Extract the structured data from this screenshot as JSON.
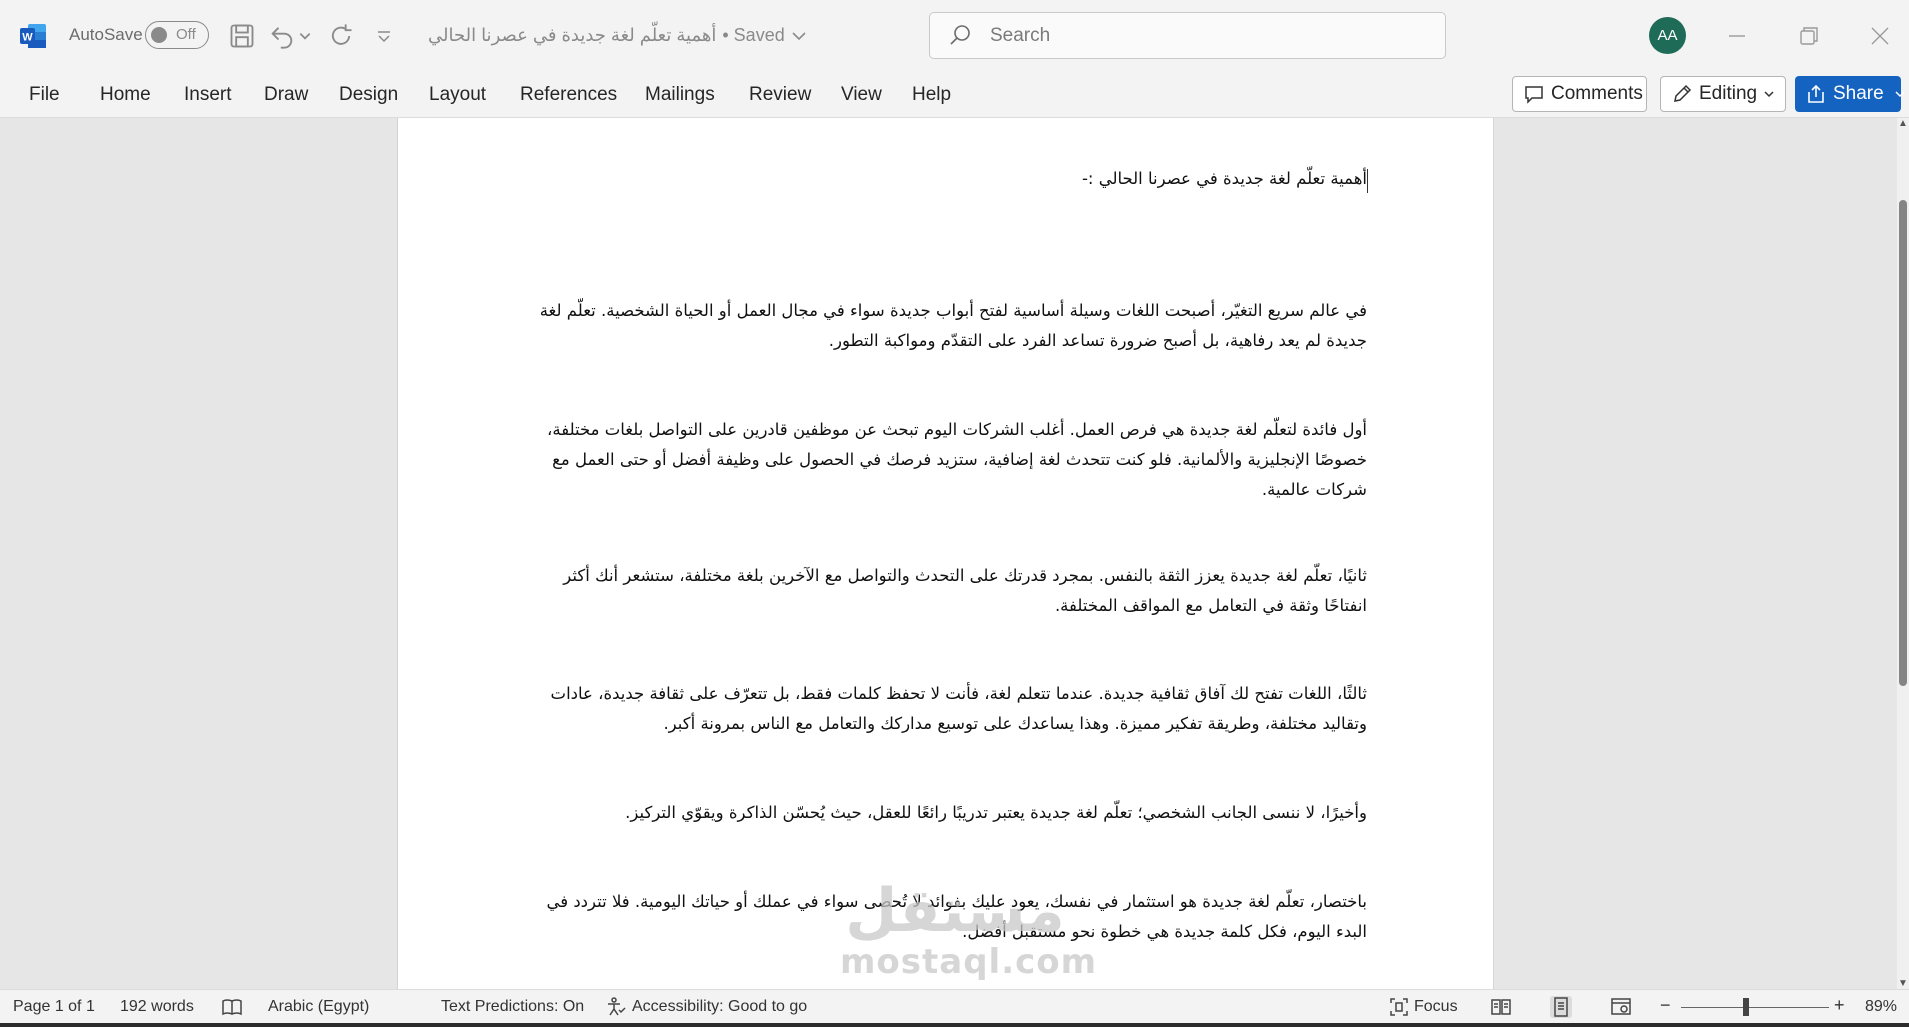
{
  "titlebar": {
    "autosave_label": "AutoSave",
    "autosave_state": "Off",
    "document_title": "أهمية تعلّم لغة جديدة في عصرنا الحالي",
    "save_status": "• Saved",
    "search_placeholder": "Search",
    "user_initials": "AA"
  },
  "ribbon": {
    "tabs": [
      "File",
      "Home",
      "Insert",
      "Draw",
      "Design",
      "Layout",
      "References",
      "Mailings",
      "Review",
      "View",
      "Help"
    ],
    "comments_label": "Comments",
    "editing_label": "Editing",
    "share_label": "Share"
  },
  "document": {
    "heading": "أهمية تعلّم لغة جديدة في عصرنا الحالي :-",
    "paragraphs": [
      "في عالم سريع التغيّر، أصبحت اللغات وسيلة أساسية لفتح أبواب جديدة سواء في مجال العمل أو الحياة الشخصية. تعلّم لغة جديدة لم يعد رفاهية، بل أصبح ضرورة تساعد الفرد على التقدّم ومواكبة التطور.",
      "أول فائدة لتعلّم لغة جديدة هي فرص العمل. أغلب الشركات اليوم تبحث عن موظفين قادرين على التواصل بلغات مختلفة، خصوصًا الإنجليزية والألمانية. فلو كنت تتحدث لغة إضافية، ستزيد فرصك في الحصول على وظيفة أفضل أو حتى العمل مع شركات عالمية.",
      "ثانيًا، تعلّم لغة جديدة يعزز الثقة بالنفس. بمجرد قدرتك على التحدث والتواصل مع الآخرين بلغة مختلفة، ستشعر أنك أكثر انفتاحًا وثقة في التعامل مع المواقف المختلفة.",
      "ثالثًا، اللغات تفتح لك آفاق ثقافية جديدة. عندما تتعلم لغة، فأنت لا تحفظ كلمات فقط، بل تتعرّف على ثقافة جديدة، عادات وتقاليد مختلفة، وطريقة تفكير مميزة. وهذا يساعدك على توسيع مداركك والتعامل مع الناس بمرونة أكبر.",
      "وأخيرًا، لا ننسى الجانب الشخصي؛ تعلّم لغة جديدة يعتبر تدريبًا رائعًا للعقل، حيث يُحسّن الذاكرة ويقوّي التركيز.",
      "باختصار، تعلّم لغة جديدة هو استثمار في نفسك، يعود عليك بفوائد لا تُحصى سواء في عملك أو حياتك اليومية. فلا تتردد في البدء اليوم، فكل كلمة جديدة هي خطوة نحو مستقبل أفضل."
    ],
    "watermark_arabic": "مستقل",
    "watermark_latin": "mostaql.com"
  },
  "statusbar": {
    "page": "Page 1 of 1",
    "words": "192 words",
    "language": "Arabic (Egypt)",
    "text_predictions": "Text Predictions: On",
    "accessibility": "Accessibility: Good to go",
    "focus": "Focus",
    "zoom": "89%",
    "zoom_minus": "−",
    "zoom_plus": "+"
  },
  "colors": {
    "word_blue": "#185abd",
    "share_blue": "#1563c1",
    "avatar_green": "#1e6b57"
  },
  "icons": [
    "word-logo-icon",
    "save-icon",
    "undo-icon",
    "redo-icon",
    "customize-icon",
    "search-icon",
    "minimize-icon",
    "restore-icon",
    "close-icon",
    "comment-icon",
    "pencil-icon",
    "share-icon",
    "book-icon",
    "accessibility-icon",
    "focus-icon",
    "read-mode-icon",
    "print-layout-icon",
    "web-layout-icon"
  ]
}
